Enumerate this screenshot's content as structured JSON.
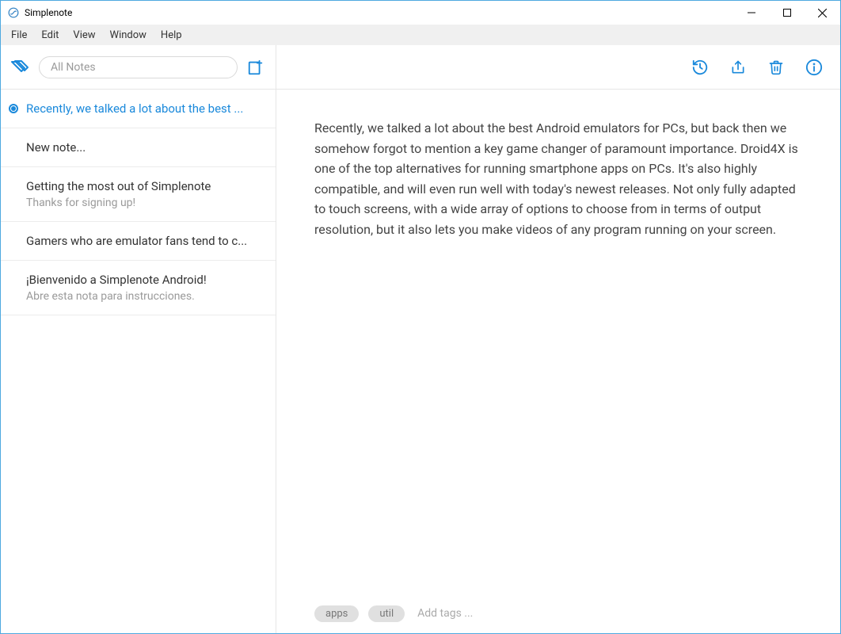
{
  "window": {
    "title": "Simplenote"
  },
  "menubar": {
    "items": [
      "File",
      "Edit",
      "View",
      "Window",
      "Help"
    ]
  },
  "sidebar": {
    "search_placeholder": "All Notes",
    "notes": [
      {
        "title": "Recently, we talked a lot about the best ...",
        "preview": "",
        "selected": true,
        "unsynced": true
      },
      {
        "title": "New note...",
        "preview": "",
        "selected": false,
        "unsynced": false
      },
      {
        "title": "Getting the most out of Simplenote",
        "preview": "Thanks for signing up!",
        "selected": false,
        "unsynced": false
      },
      {
        "title": "Gamers who are emulator fans tend to c...",
        "preview": "",
        "selected": false,
        "unsynced": false
      },
      {
        "title": "¡Bienvenido a Simplenote Android!",
        "preview": "Abre esta nota para instrucciones.",
        "selected": false,
        "unsynced": false
      }
    ]
  },
  "editor": {
    "content": "Recently, we talked a lot about the best Android emulators for PCs, but back then we somehow forgot to mention a key game changer of paramount importance. Droid4X is one of the top alternatives for running smartphone apps on PCs. It's also highly compatible, and will even run well with today's newest releases. Not only fully adapted to touch screens, with a wide array of options to choose from in terms of output resolution, but it also lets you make videos of any program running on your screen."
  },
  "tags": {
    "chips": [
      "apps",
      "util"
    ],
    "add_placeholder": "Add tags ..."
  },
  "colors": {
    "accent": "#1a89db"
  }
}
